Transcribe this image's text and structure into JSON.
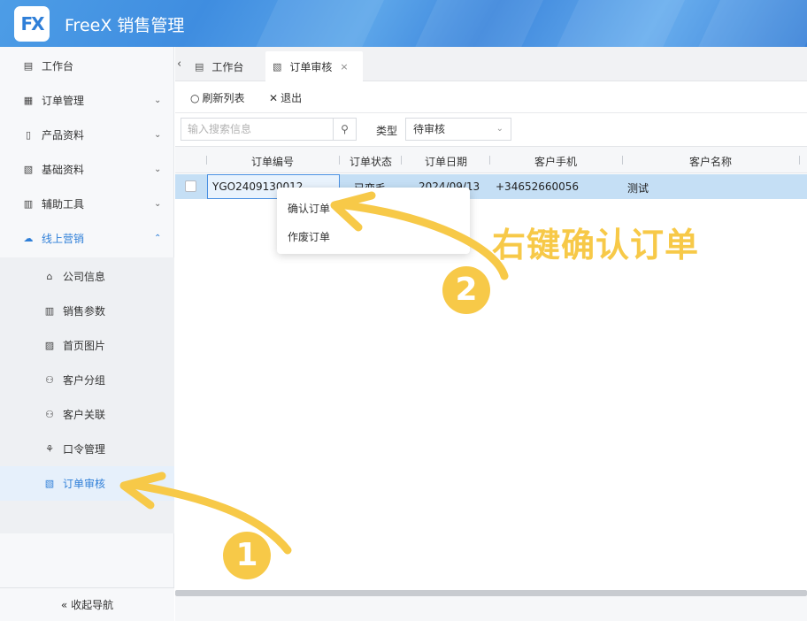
{
  "app": {
    "logo_text": "FX",
    "title": "FreeX 销售管理"
  },
  "sidebar": {
    "items": [
      {
        "label": "工作台",
        "icon": "dashboard-icon",
        "glyph": "▤"
      },
      {
        "label": "订单管理",
        "icon": "order-icon",
        "glyph": "▦",
        "chevron": "⌄"
      },
      {
        "label": "产品资料",
        "icon": "product-icon",
        "glyph": "▯",
        "chevron": "⌄"
      },
      {
        "label": "基础资料",
        "icon": "base-data-icon",
        "glyph": "▧",
        "chevron": "⌄"
      },
      {
        "label": "辅助工具",
        "icon": "tools-icon",
        "glyph": "▥",
        "chevron": "⌄"
      },
      {
        "label": "线上营销",
        "icon": "cloud-icon",
        "glyph": "☁",
        "chevron": "⌃"
      }
    ],
    "subitems": [
      {
        "label": "公司信息",
        "icon": "bank-icon",
        "glyph": "⌂"
      },
      {
        "label": "销售参数",
        "icon": "params-icon",
        "glyph": "▥"
      },
      {
        "label": "首页图片",
        "icon": "image-icon",
        "glyph": "▨"
      },
      {
        "label": "客户分组",
        "icon": "group-icon",
        "glyph": "⚇"
      },
      {
        "label": "客户关联",
        "icon": "link-icon",
        "glyph": "⚇"
      },
      {
        "label": "口令管理",
        "icon": "token-icon",
        "glyph": "⚘"
      },
      {
        "label": "订单审核",
        "icon": "audit-icon",
        "glyph": "▧"
      }
    ],
    "collapse_label": "收起导航",
    "collapse_glyph": "«"
  },
  "tabs": {
    "prev_glyph": "‹",
    "items": [
      {
        "label": "工作台",
        "glyph": "▤"
      },
      {
        "label": "订单审核",
        "glyph": "▧",
        "close": "×"
      }
    ]
  },
  "toolbar": {
    "refresh_label": "刷新列表",
    "refresh_glyph": "○",
    "exit_label": "退出",
    "exit_glyph": "✕"
  },
  "search": {
    "placeholder": "输入搜索信息",
    "search_glyph": "⚲",
    "type_label": "类型",
    "type_value": "待审核",
    "type_caret": "⌄"
  },
  "grid": {
    "columns": [
      "订单编号",
      "订单状态",
      "订单日期",
      "客户手机",
      "客户名称"
    ],
    "rows": [
      {
        "order_no": "YGO2409130012",
        "status": "已变毛",
        "date": "2024/09/13",
        "phone": "+34652660056",
        "name": "测试"
      }
    ]
  },
  "context_menu": {
    "items": [
      "确认订单",
      "作废订单"
    ]
  },
  "annotations": {
    "hint": "右键确认订单",
    "step1": "1",
    "step2": "2",
    "accent_color": "#f7c948"
  }
}
